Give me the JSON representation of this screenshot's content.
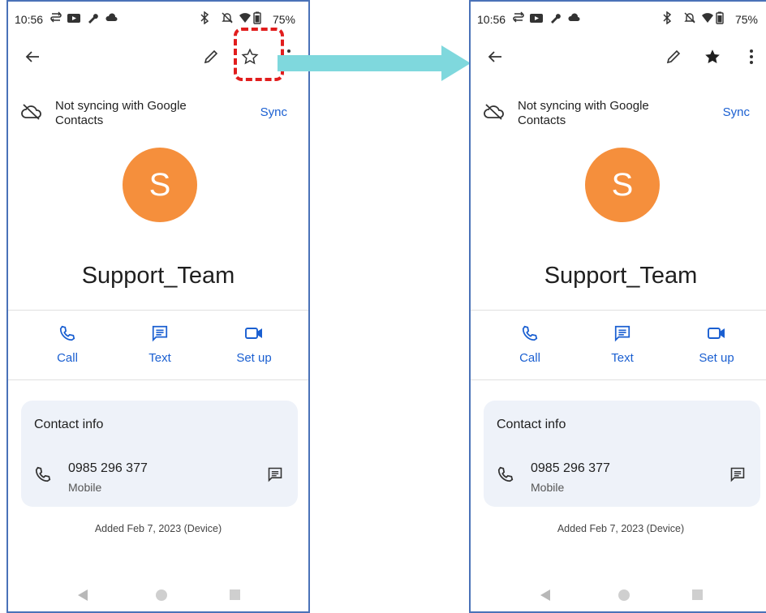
{
  "status_bar": {
    "time": "10:56",
    "battery": "75%"
  },
  "header": {
    "sync_text": "Not syncing with Google Contacts",
    "sync_link": "Sync"
  },
  "contact": {
    "initial": "S",
    "name": "Support_Team"
  },
  "actions": {
    "call": "Call",
    "text": "Text",
    "setup": "Set up"
  },
  "contact_info": {
    "title": "Contact info",
    "number": "0985 296 377",
    "type": "Mobile"
  },
  "added_text": "Added Feb 7, 2023 (Device)",
  "colors": {
    "accent": "#1a5fd1",
    "avatar": "#f58f3c",
    "card_bg": "#eef2f9",
    "highlight": "#e11d1d",
    "arrow": "#7fd8dd"
  },
  "states": {
    "left_star": "unstarred",
    "right_star": "starred"
  }
}
